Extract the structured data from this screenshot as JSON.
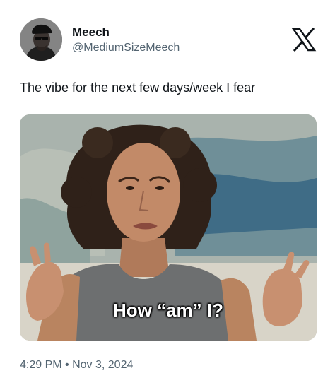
{
  "author": {
    "name": "Meech",
    "handle": "@MediumSizeMeech",
    "avatar_icon": "person-with-cap-avatar"
  },
  "logo": {
    "icon": "x-logo-icon",
    "color": "#0f1419"
  },
  "tweet": {
    "text": "The vibe for the next few days/week I fear",
    "media": {
      "caption": "How “am” I?",
      "caption_color": "#ffffff"
    },
    "date": "4:29 PM • Nov 3, 2024"
  },
  "colors": {
    "text_primary": "#0f1419",
    "text_secondary": "#536471",
    "background": "#ffffff"
  }
}
